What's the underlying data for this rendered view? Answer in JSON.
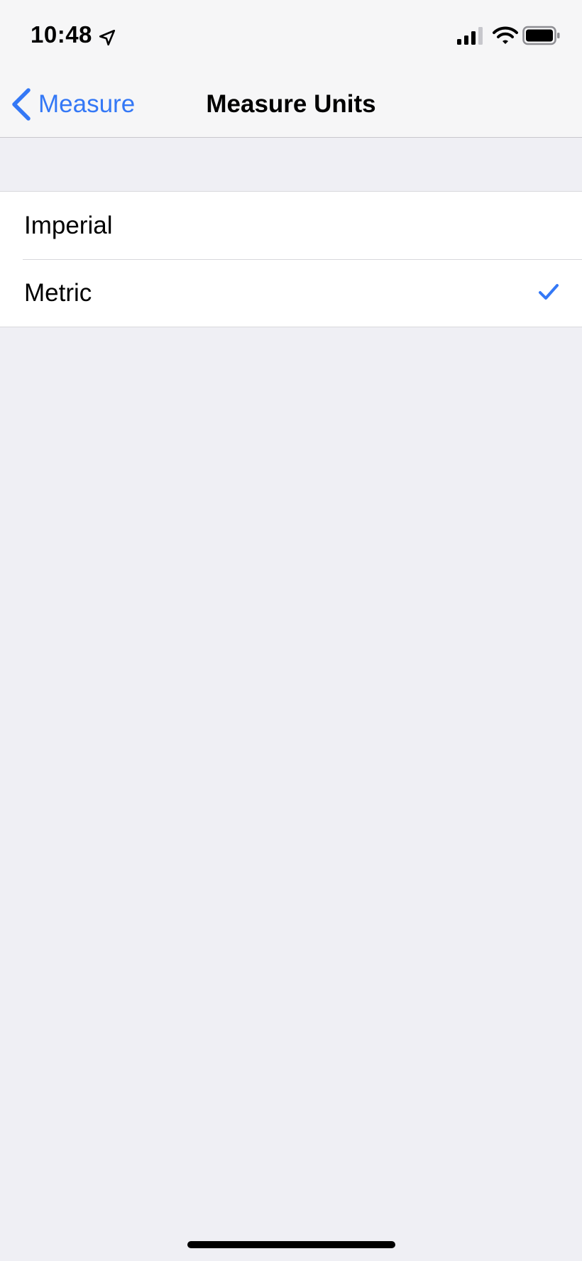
{
  "status_bar": {
    "time": "10:48",
    "icons": [
      "location-arrow-icon",
      "cellular-signal-icon",
      "wifi-icon",
      "battery-icon"
    ]
  },
  "nav": {
    "back_label": "Measure",
    "title": "Measure Units"
  },
  "options": [
    {
      "label": "Imperial",
      "selected": false
    },
    {
      "label": "Metric",
      "selected": true
    }
  ],
  "colors": {
    "accent": "#3478f6",
    "background": "#efeff4",
    "cell_background": "#ffffff",
    "separator": "#d8d8dc"
  }
}
